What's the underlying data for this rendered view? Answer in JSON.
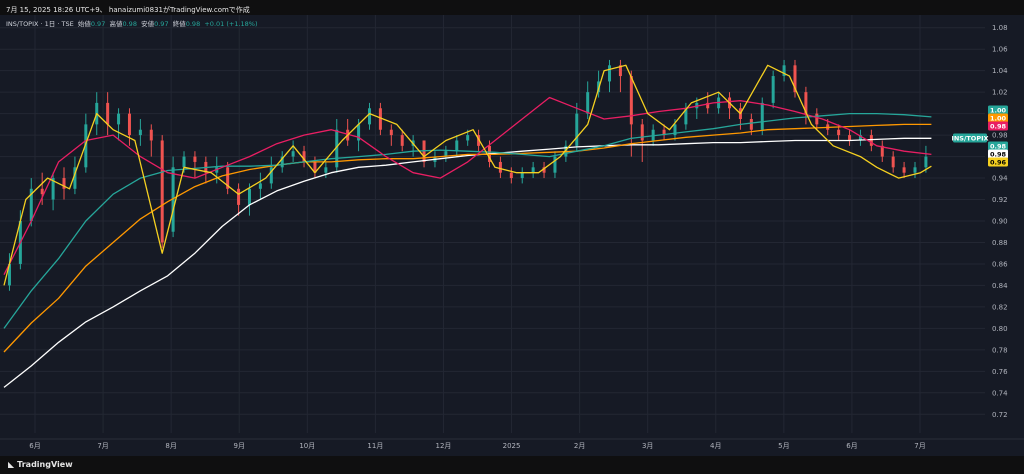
{
  "header": "7月 15, 2025 18:26 UTC+9、 hanaizumi0831がTradingView.comで作成",
  "legend": {
    "symbol": "INS/TOPIX · 1日 · TSE",
    "open_label": "始値",
    "open": "0.97",
    "high_label": "高値",
    "high": "0.98",
    "low_label": "安値",
    "low": "0.97",
    "close_label": "終値",
    "close": "0.98",
    "change": "+0.01 (+1.18%)"
  },
  "footer": {
    "brand": "TradingView",
    "logo_icon": "tradingview-logo-icon"
  },
  "colors": {
    "background": "#161a25",
    "up": "#26a69a",
    "down": "#ef5350",
    "ma_yellow": "#f5d020",
    "ma_red": "#e91e63",
    "ma_teal": "#26a69a",
    "ma_orange": "#ff9800",
    "ma_white": "#ffffff"
  },
  "chart_data": {
    "type": "line",
    "ylim": [
      0.71,
      1.09
    ],
    "grid": true,
    "yticks": [
      "1.08",
      "1.06",
      "1.04",
      "1.02",
      "1.00",
      "0.98",
      "0.96",
      "0.94",
      "0.92",
      "0.90",
      "0.88",
      "0.86",
      "0.84",
      "0.82",
      "0.80",
      "0.78",
      "0.76",
      "0.74",
      "0.72"
    ],
    "xticks": [
      "6月",
      "7月",
      "8月",
      "9月",
      "10月",
      "11月",
      "12月",
      "2025",
      "2月",
      "3月",
      "4月",
      "5月",
      "6月",
      "7月"
    ],
    "price_tags": [
      {
        "label": "1.00",
        "value": 1.0,
        "color": "#26a69a"
      },
      {
        "label": "1.00",
        "value": 0.99,
        "color": "#ff9800"
      },
      {
        "label": "0.98",
        "value": 0.98,
        "color": "#e91e63"
      },
      {
        "label": "INS/TOPIX",
        "value": 0.97,
        "color": "#26a69a"
      },
      {
        "label": "0.98",
        "value": 0.97,
        "color": "#26a69a"
      },
      {
        "label": "0.98",
        "value": 0.96,
        "color": "#ffffff"
      },
      {
        "label": "0.96",
        "value": 0.951,
        "color": "#f5d020"
      }
    ],
    "series": [
      {
        "color": "#ffffff",
        "x": [
          0,
          10,
          20,
          30,
          40,
          50,
          60,
          70,
          80,
          90,
          100,
          110,
          120,
          130,
          140,
          150,
          160,
          170,
          180,
          190,
          200,
          210,
          220,
          230,
          240,
          250,
          260,
          270,
          280,
          290,
          300,
          310,
          320,
          330,
          340
        ],
        "values": [
          0.745,
          0.765,
          0.787,
          0.806,
          0.82,
          0.835,
          0.849,
          0.87,
          0.895,
          0.915,
          0.928,
          0.937,
          0.945,
          0.95,
          0.952,
          0.955,
          0.958,
          0.961,
          0.963,
          0.965,
          0.967,
          0.969,
          0.97,
          0.971,
          0.971,
          0.972,
          0.973,
          0.973,
          0.974,
          0.975,
          0.975,
          0.975,
          0.976,
          0.977,
          0.977
        ]
      },
      {
        "color": "#ff9800",
        "x": [
          0,
          10,
          20,
          30,
          40,
          50,
          60,
          70,
          80,
          90,
          100,
          110,
          120,
          130,
          140,
          150,
          160,
          170,
          180,
          190,
          200,
          210,
          220,
          230,
          240,
          250,
          260,
          270,
          280,
          290,
          300,
          310,
          320,
          330,
          340
        ],
        "values": [
          0.778,
          0.805,
          0.828,
          0.858,
          0.88,
          0.902,
          0.918,
          0.932,
          0.942,
          0.948,
          0.952,
          0.955,
          0.955,
          0.957,
          0.958,
          0.958,
          0.96,
          0.962,
          0.962,
          0.963,
          0.964,
          0.965,
          0.968,
          0.972,
          0.975,
          0.978,
          0.98,
          0.982,
          0.985,
          0.986,
          0.987,
          0.988,
          0.989,
          0.99,
          0.99
        ]
      },
      {
        "color": "#26a69a",
        "x": [
          0,
          10,
          20,
          30,
          40,
          50,
          60,
          70,
          80,
          90,
          100,
          110,
          120,
          130,
          140,
          150,
          160,
          170,
          180,
          190,
          200,
          210,
          220,
          230,
          240,
          250,
          260,
          270,
          280,
          290,
          300,
          310,
          320,
          330,
          340
        ],
        "values": [
          0.8,
          0.835,
          0.865,
          0.9,
          0.925,
          0.94,
          0.947,
          0.949,
          0.951,
          0.951,
          0.952,
          0.955,
          0.958,
          0.96,
          0.962,
          0.965,
          0.966,
          0.965,
          0.964,
          0.962,
          0.96,
          0.965,
          0.97,
          0.977,
          0.98,
          0.983,
          0.986,
          0.99,
          0.993,
          0.996,
          0.998,
          1.0,
          1.0,
          0.999,
          0.997
        ]
      },
      {
        "color": "#e91e63",
        "x": [
          0,
          10,
          20,
          30,
          40,
          50,
          60,
          70,
          80,
          90,
          100,
          110,
          120,
          130,
          140,
          150,
          160,
          170,
          180,
          190,
          200,
          210,
          220,
          230,
          240,
          250,
          260,
          270,
          280,
          290,
          300,
          310,
          320,
          330,
          340
        ],
        "values": [
          0.85,
          0.9,
          0.955,
          0.975,
          0.98,
          0.96,
          0.945,
          0.94,
          0.95,
          0.96,
          0.972,
          0.98,
          0.985,
          0.978,
          0.96,
          0.945,
          0.94,
          0.955,
          0.975,
          0.995,
          1.015,
          1.005,
          0.995,
          0.998,
          1.002,
          1.005,
          1.01,
          1.012,
          1.008,
          1.002,
          0.995,
          0.985,
          0.97,
          0.965,
          0.962
        ]
      },
      {
        "color": "#f5d020",
        "x": [
          0,
          8,
          16,
          24,
          34,
          40,
          48,
          58,
          66,
          76,
          86,
          96,
          106,
          114,
          124,
          134,
          144,
          154,
          162,
          172,
          180,
          188,
          196,
          204,
          214,
          220,
          228,
          236,
          244,
          252,
          262,
          270,
          280,
          288,
          296,
          304,
          314,
          320,
          328,
          336,
          340
        ],
        "values": [
          0.84,
          0.92,
          0.94,
          0.93,
          1.0,
          0.985,
          0.975,
          0.87,
          0.95,
          0.945,
          0.925,
          0.94,
          0.97,
          0.945,
          0.975,
          1.0,
          0.99,
          0.96,
          0.975,
          0.985,
          0.95,
          0.945,
          0.945,
          0.96,
          0.99,
          1.04,
          1.045,
          1.0,
          0.985,
          1.01,
          1.02,
          1.0,
          1.045,
          1.035,
          0.99,
          0.97,
          0.96,
          0.95,
          0.94,
          0.945,
          0.951
        ]
      }
    ],
    "candles": [
      {
        "x": 2,
        "o": 0.84,
        "c": 0.86,
        "h": 0.87,
        "l": 0.835
      },
      {
        "x": 6,
        "o": 0.86,
        "c": 0.9,
        "h": 0.91,
        "l": 0.855
      },
      {
        "x": 10,
        "o": 0.9,
        "c": 0.93,
        "h": 0.94,
        "l": 0.895
      },
      {
        "x": 14,
        "o": 0.93,
        "c": 0.925,
        "h": 0.945,
        "l": 0.915
      },
      {
        "x": 18,
        "o": 0.92,
        "c": 0.94,
        "h": 0.945,
        "l": 0.91
      },
      {
        "x": 22,
        "o": 0.94,
        "c": 0.93,
        "h": 0.95,
        "l": 0.92
      },
      {
        "x": 26,
        "o": 0.93,
        "c": 0.95,
        "h": 0.96,
        "l": 0.925
      },
      {
        "x": 30,
        "o": 0.95,
        "c": 0.99,
        "h": 1.0,
        "l": 0.945
      },
      {
        "x": 34,
        "o": 0.99,
        "c": 1.01,
        "h": 1.02,
        "l": 0.98
      },
      {
        "x": 38,
        "o": 1.01,
        "c": 0.99,
        "h": 1.02,
        "l": 0.98
      },
      {
        "x": 42,
        "o": 0.99,
        "c": 1.0,
        "h": 1.005,
        "l": 0.975
      },
      {
        "x": 46,
        "o": 1.0,
        "c": 0.98,
        "h": 1.005,
        "l": 0.97
      },
      {
        "x": 50,
        "o": 0.98,
        "c": 0.985,
        "h": 0.995,
        "l": 0.97
      },
      {
        "x": 54,
        "o": 0.985,
        "c": 0.975,
        "h": 0.99,
        "l": 0.96
      },
      {
        "x": 58,
        "o": 0.975,
        "c": 0.88,
        "h": 0.98,
        "l": 0.875
      },
      {
        "x": 62,
        "o": 0.89,
        "c": 0.95,
        "h": 0.96,
        "l": 0.885
      },
      {
        "x": 66,
        "o": 0.95,
        "c": 0.96,
        "h": 0.965,
        "l": 0.945
      },
      {
        "x": 70,
        "o": 0.96,
        "c": 0.955,
        "h": 0.965,
        "l": 0.94
      },
      {
        "x": 74,
        "o": 0.955,
        "c": 0.945,
        "h": 0.96,
        "l": 0.935
      },
      {
        "x": 78,
        "o": 0.945,
        "c": 0.95,
        "h": 0.96,
        "l": 0.935
      },
      {
        "x": 82,
        "o": 0.95,
        "c": 0.93,
        "h": 0.955,
        "l": 0.925
      },
      {
        "x": 86,
        "o": 0.93,
        "c": 0.915,
        "h": 0.935,
        "l": 0.905
      },
      {
        "x": 90,
        "o": 0.915,
        "c": 0.93,
        "h": 0.935,
        "l": 0.905
      },
      {
        "x": 94,
        "o": 0.93,
        "c": 0.935,
        "h": 0.945,
        "l": 0.92
      },
      {
        "x": 98,
        "o": 0.935,
        "c": 0.95,
        "h": 0.96,
        "l": 0.93
      },
      {
        "x": 102,
        "o": 0.95,
        "c": 0.96,
        "h": 0.965,
        "l": 0.945
      },
      {
        "x": 106,
        "o": 0.96,
        "c": 0.965,
        "h": 0.975,
        "l": 0.955
      },
      {
        "x": 110,
        "o": 0.965,
        "c": 0.955,
        "h": 0.97,
        "l": 0.95
      },
      {
        "x": 114,
        "o": 0.955,
        "c": 0.945,
        "h": 0.96,
        "l": 0.94
      },
      {
        "x": 118,
        "o": 0.945,
        "c": 0.95,
        "h": 0.955,
        "l": 0.94
      },
      {
        "x": 122,
        "o": 0.95,
        "c": 0.985,
        "h": 0.995,
        "l": 0.945
      },
      {
        "x": 126,
        "o": 0.985,
        "c": 0.975,
        "h": 0.995,
        "l": 0.97
      },
      {
        "x": 130,
        "o": 0.975,
        "c": 0.99,
        "h": 0.995,
        "l": 0.965
      },
      {
        "x": 134,
        "o": 0.99,
        "c": 1.005,
        "h": 1.01,
        "l": 0.985
      },
      {
        "x": 138,
        "o": 1.005,
        "c": 0.985,
        "h": 1.01,
        "l": 0.98
      },
      {
        "x": 142,
        "o": 0.985,
        "c": 0.98,
        "h": 0.99,
        "l": 0.97
      },
      {
        "x": 146,
        "o": 0.98,
        "c": 0.97,
        "h": 0.985,
        "l": 0.965
      },
      {
        "x": 150,
        "o": 0.97,
        "c": 0.975,
        "h": 0.98,
        "l": 0.96
      },
      {
        "x": 154,
        "o": 0.975,
        "c": 0.955,
        "h": 0.975,
        "l": 0.95
      },
      {
        "x": 158,
        "o": 0.955,
        "c": 0.96,
        "h": 0.965,
        "l": 0.95
      },
      {
        "x": 162,
        "o": 0.96,
        "c": 0.965,
        "h": 0.97,
        "l": 0.955
      },
      {
        "x": 166,
        "o": 0.965,
        "c": 0.975,
        "h": 0.98,
        "l": 0.96
      },
      {
        "x": 170,
        "o": 0.975,
        "c": 0.98,
        "h": 0.985,
        "l": 0.97
      },
      {
        "x": 174,
        "o": 0.98,
        "c": 0.97,
        "h": 0.985,
        "l": 0.965
      },
      {
        "x": 178,
        "o": 0.97,
        "c": 0.955,
        "h": 0.975,
        "l": 0.95
      },
      {
        "x": 182,
        "o": 0.955,
        "c": 0.945,
        "h": 0.96,
        "l": 0.94
      },
      {
        "x": 186,
        "o": 0.945,
        "c": 0.94,
        "h": 0.95,
        "l": 0.935
      },
      {
        "x": 190,
        "o": 0.94,
        "c": 0.945,
        "h": 0.95,
        "l": 0.935
      },
      {
        "x": 194,
        "o": 0.945,
        "c": 0.95,
        "h": 0.955,
        "l": 0.94
      },
      {
        "x": 198,
        "o": 0.95,
        "c": 0.945,
        "h": 0.955,
        "l": 0.94
      },
      {
        "x": 202,
        "o": 0.945,
        "c": 0.96,
        "h": 0.965,
        "l": 0.94
      },
      {
        "x": 206,
        "o": 0.96,
        "c": 0.97,
        "h": 0.975,
        "l": 0.955
      },
      {
        "x": 210,
        "o": 0.97,
        "c": 1.0,
        "h": 1.01,
        "l": 0.965
      },
      {
        "x": 214,
        "o": 1.0,
        "c": 1.02,
        "h": 1.03,
        "l": 0.995
      },
      {
        "x": 218,
        "o": 1.02,
        "c": 1.03,
        "h": 1.04,
        "l": 1.015
      },
      {
        "x": 222,
        "o": 1.03,
        "c": 1.045,
        "h": 1.05,
        "l": 1.02
      },
      {
        "x": 226,
        "o": 1.045,
        "c": 1.035,
        "h": 1.05,
        "l": 1.02
      },
      {
        "x": 230,
        "o": 1.035,
        "c": 0.99,
        "h": 1.04,
        "l": 0.96
      },
      {
        "x": 234,
        "o": 0.99,
        "c": 0.975,
        "h": 0.995,
        "l": 0.955
      },
      {
        "x": 238,
        "o": 0.975,
        "c": 0.985,
        "h": 0.99,
        "l": 0.97
      },
      {
        "x": 242,
        "o": 0.985,
        "c": 0.98,
        "h": 0.99,
        "l": 0.975
      },
      {
        "x": 246,
        "o": 0.98,
        "c": 0.99,
        "h": 0.995,
        "l": 0.975
      },
      {
        "x": 250,
        "o": 0.99,
        "c": 1.005,
        "h": 1.01,
        "l": 0.985
      },
      {
        "x": 254,
        "o": 1.005,
        "c": 1.01,
        "h": 1.015,
        "l": 0.995
      },
      {
        "x": 258,
        "o": 1.01,
        "c": 1.005,
        "h": 1.02,
        "l": 1.0
      },
      {
        "x": 262,
        "o": 1.005,
        "c": 1.015,
        "h": 1.02,
        "l": 1.0
      },
      {
        "x": 266,
        "o": 1.015,
        "c": 1.005,
        "h": 1.02,
        "l": 0.995
      },
      {
        "x": 270,
        "o": 1.005,
        "c": 0.995,
        "h": 1.01,
        "l": 0.985
      },
      {
        "x": 274,
        "o": 0.995,
        "c": 0.985,
        "h": 1.0,
        "l": 0.98
      },
      {
        "x": 278,
        "o": 0.985,
        "c": 1.01,
        "h": 1.015,
        "l": 0.98
      },
      {
        "x": 282,
        "o": 1.01,
        "c": 1.035,
        "h": 1.04,
        "l": 1.005
      },
      {
        "x": 286,
        "o": 1.035,
        "c": 1.045,
        "h": 1.05,
        "l": 1.03
      },
      {
        "x": 290,
        "o": 1.045,
        "c": 1.02,
        "h": 1.05,
        "l": 1.015
      },
      {
        "x": 294,
        "o": 1.02,
        "c": 1.0,
        "h": 1.025,
        "l": 0.99
      },
      {
        "x": 298,
        "o": 1.0,
        "c": 0.99,
        "h": 1.005,
        "l": 0.985
      },
      {
        "x": 302,
        "o": 0.99,
        "c": 0.985,
        "h": 0.995,
        "l": 0.98
      },
      {
        "x": 306,
        "o": 0.985,
        "c": 0.98,
        "h": 0.99,
        "l": 0.975
      },
      {
        "x": 310,
        "o": 0.98,
        "c": 0.975,
        "h": 0.985,
        "l": 0.97
      },
      {
        "x": 314,
        "o": 0.975,
        "c": 0.98,
        "h": 0.985,
        "l": 0.97
      },
      {
        "x": 318,
        "o": 0.98,
        "c": 0.97,
        "h": 0.985,
        "l": 0.965
      },
      {
        "x": 322,
        "o": 0.97,
        "c": 0.96,
        "h": 0.975,
        "l": 0.955
      },
      {
        "x": 326,
        "o": 0.96,
        "c": 0.95,
        "h": 0.965,
        "l": 0.945
      },
      {
        "x": 330,
        "o": 0.95,
        "c": 0.945,
        "h": 0.955,
        "l": 0.94
      },
      {
        "x": 334,
        "o": 0.945,
        "c": 0.95,
        "h": 0.955,
        "l": 0.94
      },
      {
        "x": 338,
        "o": 0.95,
        "c": 0.96,
        "h": 0.97,
        "l": 0.945
      }
    ]
  }
}
